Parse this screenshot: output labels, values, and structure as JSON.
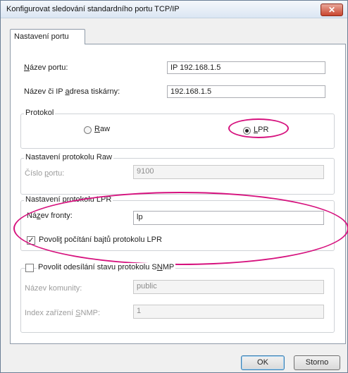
{
  "window": {
    "title": "Konfigurovat sledování standardního portu TCP/IP",
    "close_glyph": "✕"
  },
  "tabs": [
    {
      "label": "Nastavení portu"
    }
  ],
  "port_name": {
    "label_u": "N",
    "label_rest": "ázev portu:",
    "value": "IP 192.168.1.5"
  },
  "printer_address": {
    "label_pre": "Název či IP ",
    "label_u": "a",
    "label_rest": "dresa tiskárny:",
    "value": "192.168.1.5"
  },
  "protocol": {
    "title": "Protokol",
    "raw_u": "R",
    "raw_rest": "aw",
    "lpr_u": "L",
    "lpr_rest": "PR",
    "selected": "LPR"
  },
  "raw_settings": {
    "title": "Nastavení protokolu Raw",
    "port_label_pre": "Číslo ",
    "port_label_u": "p",
    "port_label_rest": "ortu:",
    "port_value": "9100"
  },
  "lpr_settings": {
    "title": "Nastavení protokolu LPR",
    "queue_label_pre": "Ná",
    "queue_label_u": "z",
    "queue_label_rest": "ev fronty:",
    "queue_value": "lp",
    "byte_count_pre": "Povoli",
    "byte_count_u": "t",
    "byte_count_rest": " počítání bajtů protokolu LPR",
    "byte_count_checked": true
  },
  "snmp": {
    "enable_pre": "Povolit odesílání stavu protokolu S",
    "enable_u": "N",
    "enable_rest": "MP",
    "enabled": false,
    "community_label": "Název komunity:",
    "community_value": "public",
    "device_label_pre": "Index zařízení ",
    "device_label_u": "S",
    "device_label_rest": "NMP:",
    "device_value": "1"
  },
  "buttons": {
    "ok": "OK",
    "cancel": "Storno"
  },
  "highlight_color": "#d6127e"
}
